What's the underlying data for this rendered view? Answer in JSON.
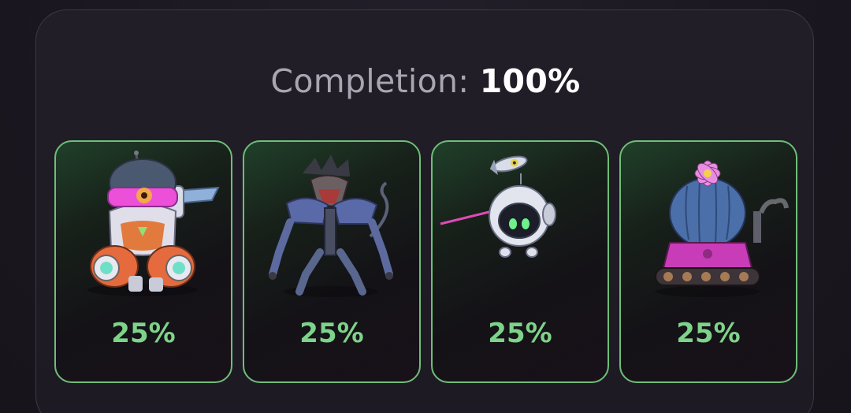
{
  "completion": {
    "label": "Completion:",
    "value": "100%"
  },
  "cards": [
    {
      "name": "astronaut-mech",
      "percent": "25%"
    },
    {
      "name": "cyber-werewolf",
      "percent": "25%"
    },
    {
      "name": "orb-drone",
      "percent": "25%"
    },
    {
      "name": "cactus-tank",
      "percent": "25%"
    }
  ],
  "colors": {
    "accent_green": "#7ed38a",
    "card_border": "#6fbe78",
    "panel_border": "#3d3846"
  }
}
